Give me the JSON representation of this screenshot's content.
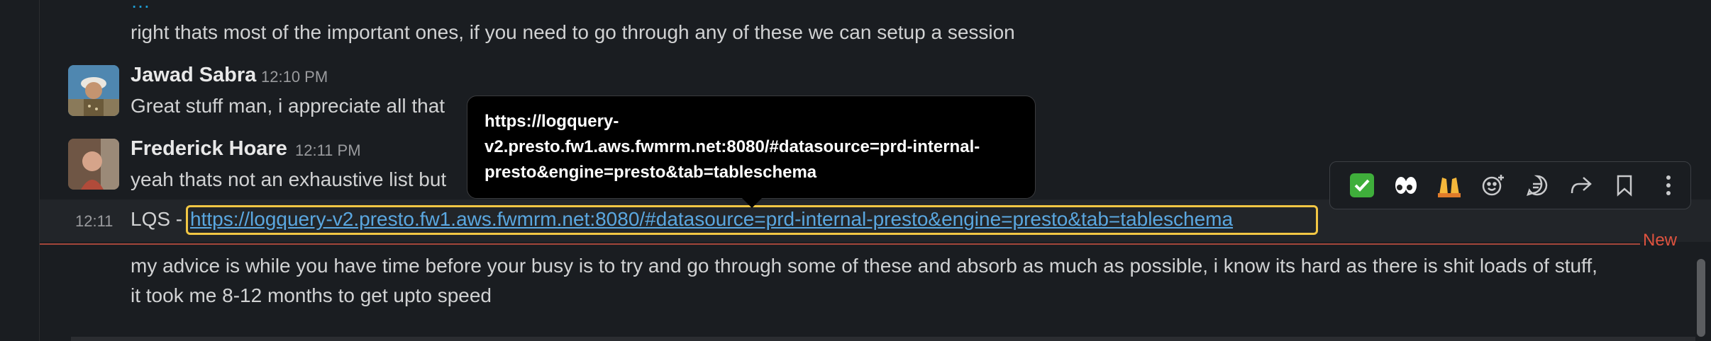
{
  "top_partial_text": "…",
  "messages": [
    {
      "text": "right thats most of the important ones, if you need to go through any of these we can setup a session"
    },
    {
      "author": "Jawad Sabra",
      "time": "12:10 PM",
      "text": "Great stuff man, i appreciate all that"
    },
    {
      "author": "Frederick Hoare",
      "time": "12:11 PM",
      "text": "yeah thats not an exhaustive list but"
    },
    {
      "time": "12:11",
      "prefix": "LQS - ",
      "link": "https://logquery-v2.presto.fw1.aws.fwmrm.net:8080/#datasource=prd-internal-presto&engine=presto&tab=tableschema"
    },
    {
      "text_line1": "my advice is while you have time before your busy is to try and go through some of these and absorb as much as possible, i know its hard as there is shit loads of stuff,",
      "text_line2": "it took me 8-12 months to get upto speed"
    }
  ],
  "tooltip": {
    "line1": "https://logquery-",
    "line2": "v2.presto.fw1.aws.fwmrm.net:8080/#datasource=prd-internal-",
    "line3": "presto&engine=presto&tab=tableschema"
  },
  "new_divider_label": "New",
  "toolbar": {
    "items": [
      "white-check-mark-reaction",
      "eyes-reaction",
      "raised-hands-reaction",
      "add-reaction",
      "reply-in-thread",
      "forward-message",
      "save-for-later",
      "more-actions"
    ]
  },
  "colors": {
    "background": "#1a1d21",
    "link": "#5aa7e0",
    "focus_outline": "#f2c744",
    "new_divider": "#e0533f"
  }
}
